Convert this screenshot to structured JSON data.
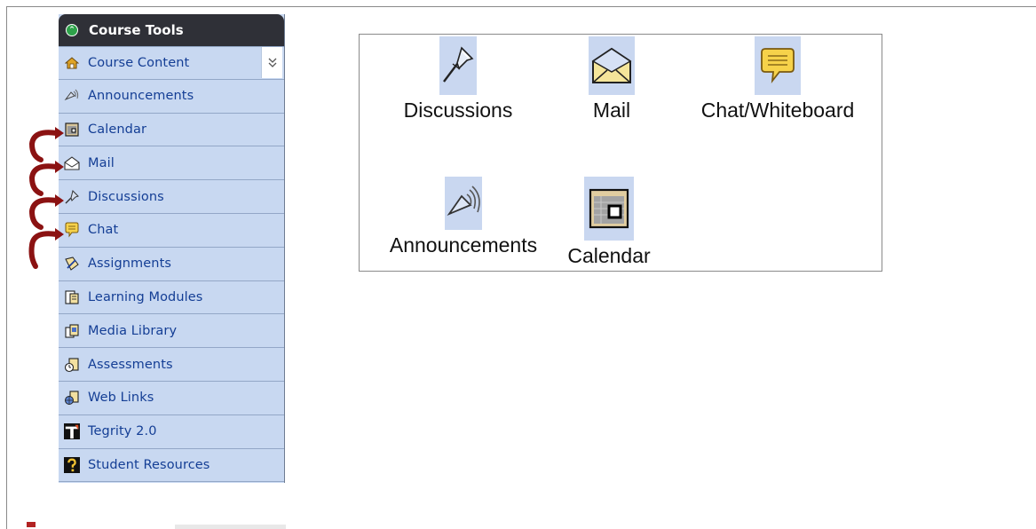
{
  "sidebar": {
    "title": "Course Tools",
    "items": [
      {
        "label": "Course Content",
        "icon": "home-icon"
      },
      {
        "label": "Announcements",
        "icon": "megaphone-icon"
      },
      {
        "label": "Calendar",
        "icon": "calendar-icon"
      },
      {
        "label": "Mail",
        "icon": "mail-icon"
      },
      {
        "label": "Discussions",
        "icon": "pushpin-icon"
      },
      {
        "label": "Chat",
        "icon": "chat-bubble-icon"
      },
      {
        "label": "Assignments",
        "icon": "assignment-icon"
      },
      {
        "label": "Learning Modules",
        "icon": "learning-modules-icon"
      },
      {
        "label": "Media Library",
        "icon": "media-library-icon"
      },
      {
        "label": "Assessments",
        "icon": "assessment-icon"
      },
      {
        "label": "Web Links",
        "icon": "web-links-icon"
      },
      {
        "label": "Tegrity 2.0",
        "icon": "tegrity-icon"
      },
      {
        "label": "Student Resources",
        "icon": "question-icon"
      }
    ]
  },
  "tools": {
    "discussions": "Discussions",
    "mail": "Mail",
    "chat": "Chat/Whiteboard",
    "announcements": "Announcements",
    "calendar": "Calendar"
  },
  "colors": {
    "sidebar_bg": "#c8d8f1",
    "header_bg": "#2f3037",
    "link_text": "#143e95",
    "arrow": "#8b1212"
  }
}
